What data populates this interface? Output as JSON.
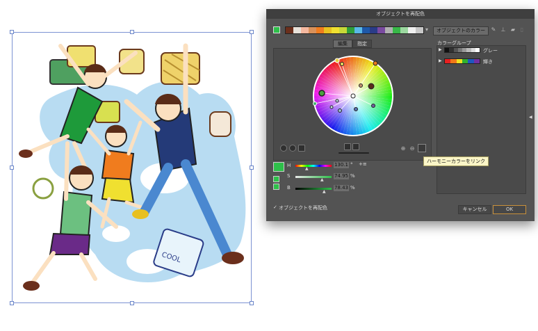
{
  "dialog": {
    "title": "オブジェクトを再配色",
    "current_swatch_color": "#2ec04a",
    "strip_colors": [
      "#6b2f1c",
      "#e8e2da",
      "#f4b8a0",
      "#d9915a",
      "#f07c1e",
      "#e8c020",
      "#f0e030",
      "#c8d838",
      "#2f9e3a",
      "#5ab8e8",
      "#1e58a8",
      "#2a3c88",
      "#7a4aa0",
      "#b0b0b0",
      "#38b848",
      "#9cd8a0",
      "#f0f0f0",
      "#c8c8c8"
    ],
    "object_colors_label": "オブジェクトのカラー",
    "tabs": {
      "edit": "編集",
      "assign": "指定"
    },
    "color_groups_title": "カラーグループ",
    "groups": [
      {
        "name": "グレー",
        "colors": [
          "#111111",
          "#333333",
          "#555555",
          "#777777",
          "#999999",
          "#bbbbbb",
          "#dddddd",
          "#ffffff"
        ]
      },
      {
        "name": "輝き",
        "colors": [
          "#e82020",
          "#f07818",
          "#f0e020",
          "#30b030",
          "#1e58c0",
          "#7030a0"
        ]
      }
    ],
    "h_label": "H",
    "h_value": "130.1",
    "h_unit": "°",
    "s_label": "S",
    "s_value": "74.95",
    "s_unit": "%",
    "b_label": "B",
    "b_value": "78.43",
    "b_unit": "%",
    "tooltip": "ハーモニーカラーをリンク",
    "recolor_checkbox_label": "オブジェクトを再配色",
    "recolor_checked": true,
    "cancel_label": "キャンセル",
    "ok_label": "OK"
  }
}
